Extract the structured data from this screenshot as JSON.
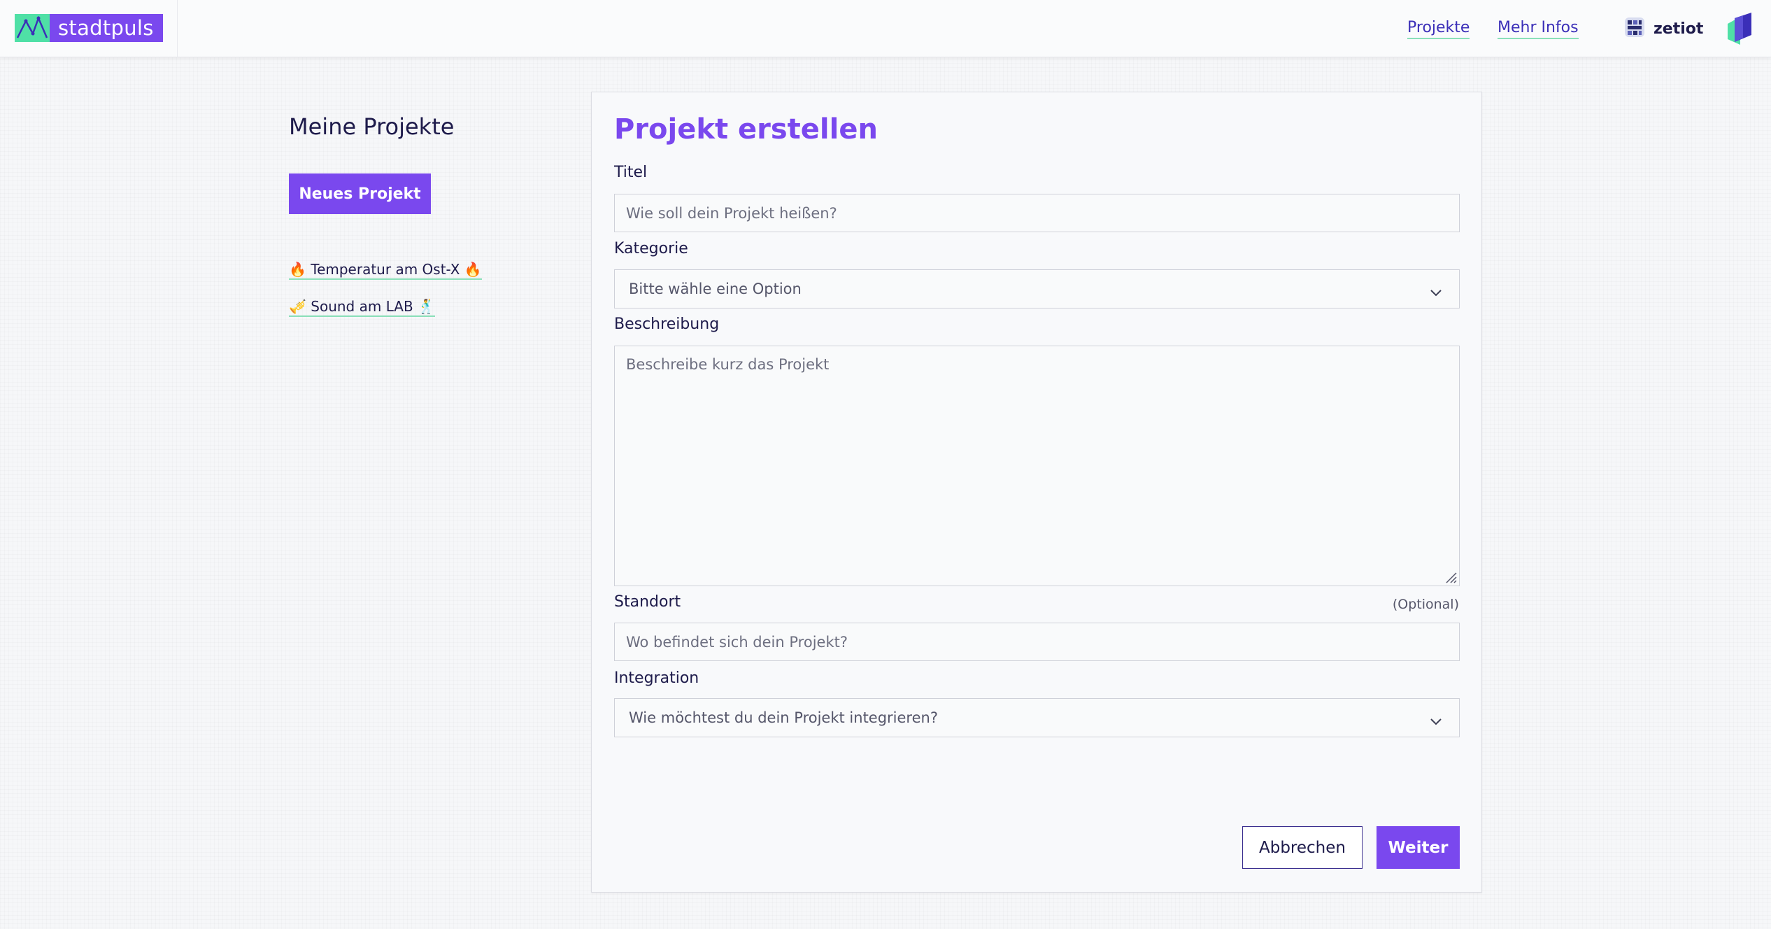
{
  "header": {
    "logo_text": "stadtpuls",
    "nav": [
      {
        "label": "Projekte"
      },
      {
        "label": "Mehr Infos"
      }
    ],
    "partner_name": "zetiot",
    "colors": {
      "accent": "#7a48ee",
      "mint": "#4fe0a6",
      "link": "#3b2fb8"
    }
  },
  "sidebar": {
    "title": "Meine Projekte",
    "new_project_button": "Neues Projekt",
    "projects": [
      {
        "label": "🔥 Temperatur am Ost-X 🔥"
      },
      {
        "label": "🎺 Sound am LAB 🕺"
      }
    ]
  },
  "form": {
    "title": "Projekt erstellen",
    "title_field": {
      "label": "Titel",
      "placeholder": "Wie soll dein Projekt heißen?",
      "value": ""
    },
    "category_field": {
      "label": "Kategorie",
      "selected": "Bitte wähle eine Option"
    },
    "description_field": {
      "label": "Beschreibung",
      "placeholder": "Beschreibe kurz das Projekt",
      "value": ""
    },
    "location_field": {
      "label": "Standort",
      "optional_note": "(Optional)",
      "placeholder": "Wo befindet sich dein Projekt?",
      "value": ""
    },
    "integration_field": {
      "label": "Integration",
      "selected": "Wie möchtest du dein Projekt integrieren?"
    },
    "cancel_button": "Abbrechen",
    "submit_button": "Weiter"
  }
}
